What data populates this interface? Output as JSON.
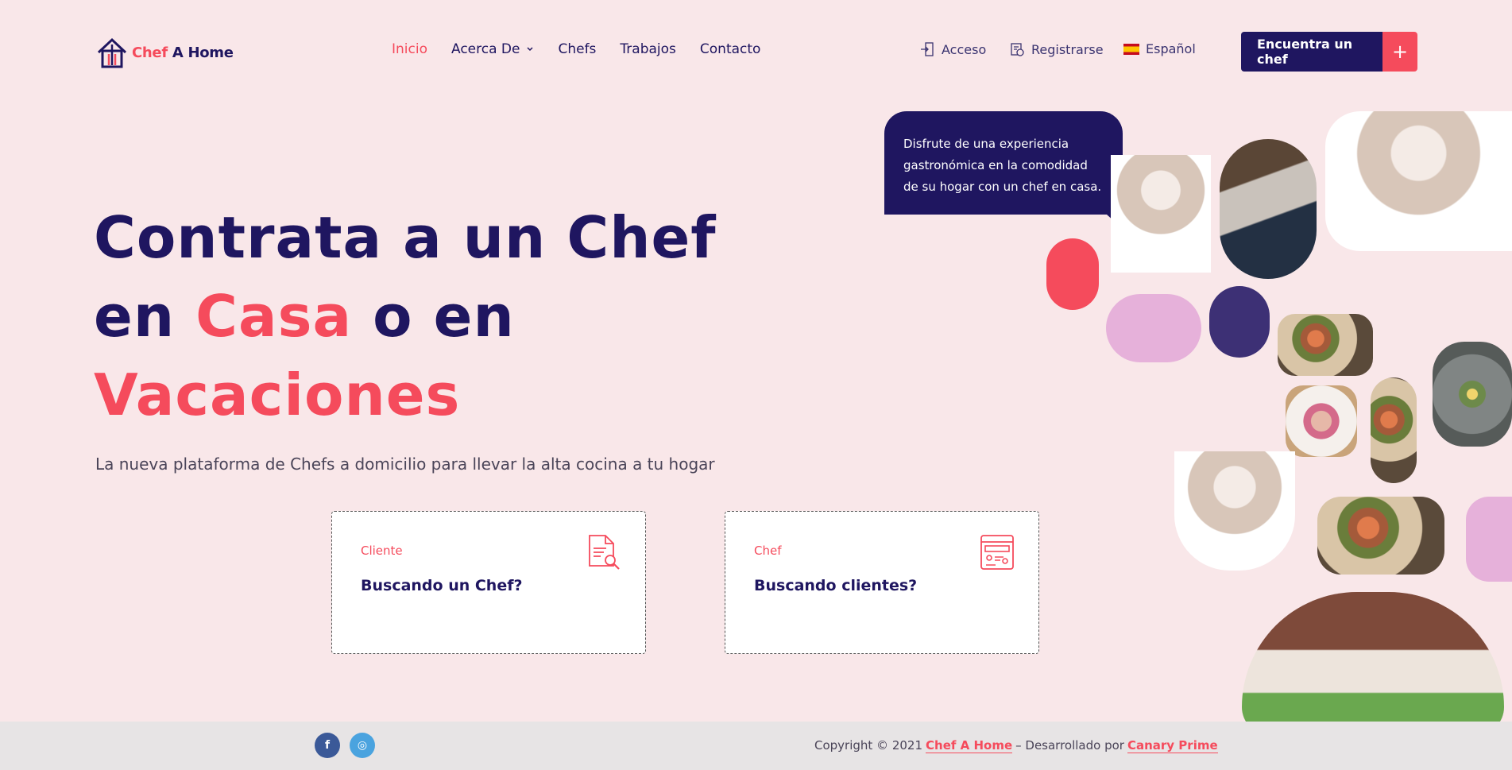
{
  "brand": {
    "logo_red": "Chef",
    "logo_dark": "A Home"
  },
  "nav": [
    {
      "label": "Inicio",
      "active": true
    },
    {
      "label": "Acerca De",
      "dropdown": true
    },
    {
      "label": "Chefs"
    },
    {
      "label": "Trabajos"
    },
    {
      "label": "Contacto"
    }
  ],
  "account": {
    "login": "Acceso",
    "register": "Registrarse",
    "language": "Español"
  },
  "cta": {
    "label": "Encuentra un chef",
    "plus": "+"
  },
  "hero": {
    "line1": "Contrata a un Chef",
    "line2_a": "en ",
    "line2_red": "Casa",
    "line2_b": " o en",
    "line3_red": "Vacaciones",
    "subtitle": "La nueva plataforma de Chefs a domicilio para llevar la alta cocina a tu hogar"
  },
  "cards": [
    {
      "kicker": "Cliente",
      "title": "Buscando un Chef?",
      "icon": "document-search-icon"
    },
    {
      "kicker": "Chef",
      "title": "Buscando clientes?",
      "icon": "profile-dashboard-icon"
    }
  ],
  "bubble": {
    "text": "Disfrute de una experiencia gastronómica en la comodidad de su hogar con un chef en casa."
  },
  "footer": {
    "copyright_prefix": "Copyright © 2021",
    "brand_link": "Chef A Home",
    "middle": "– Desarrollado por",
    "dev_link": "Canary Prime",
    "facebook": "f",
    "instagram": "◎"
  },
  "colors": {
    "navy": "#1f1660",
    "coral": "#f54b5c",
    "background": "#f9e7e9",
    "pink": "#e6b1da",
    "purple": "#3d3075"
  }
}
